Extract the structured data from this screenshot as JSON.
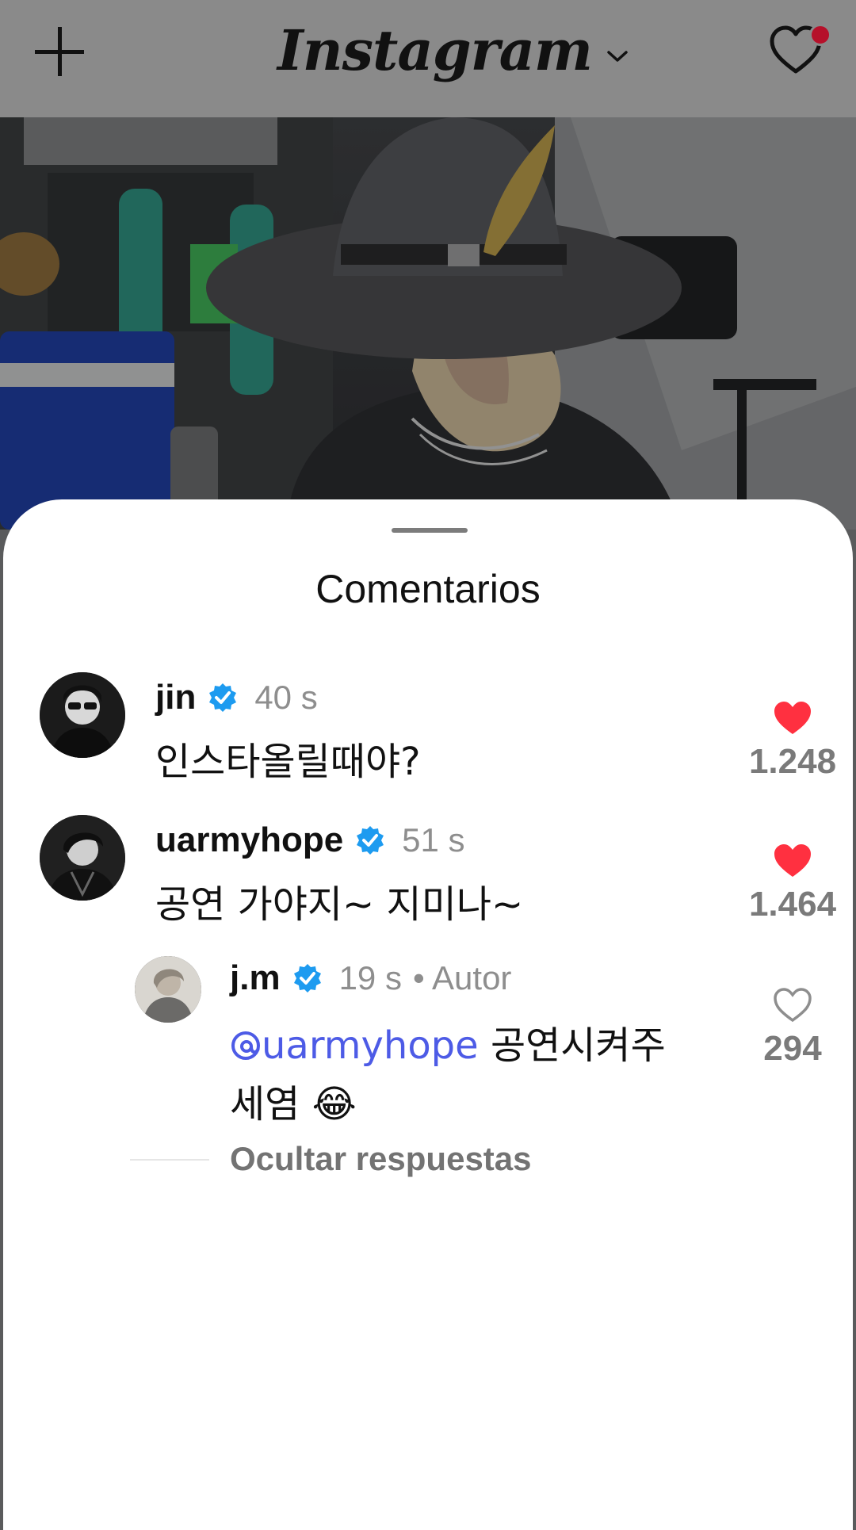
{
  "header": {
    "brand": "Instagram",
    "add_icon": "plus-icon",
    "activity_icon": "heart-icon",
    "notification_color": "#b6102a"
  },
  "sheet": {
    "title": "Comentarios",
    "hide_replies_label": "Ocultar respuestas"
  },
  "comments": [
    {
      "username": "jin",
      "verified": true,
      "time": "40 s",
      "text": "인스타올릴때야?",
      "likes": "1.248",
      "liked": true
    },
    {
      "username": "uarmyhope",
      "verified": true,
      "time": "51 s",
      "text": "공연 가야지~ 지미나~",
      "likes": "1.464",
      "liked": true
    }
  ],
  "reply": {
    "username": "j.m",
    "verified": true,
    "time": "19 s",
    "author_tag": "• Autor",
    "mention": "uarmyhope",
    "text": "공연시켜주",
    "text_line2": "세염 😂",
    "likes": "294",
    "liked": false
  },
  "colors": {
    "like_red": "#ff3040",
    "verified_blue": "#1d9bf0",
    "mention_blue": "#4d5be6"
  }
}
